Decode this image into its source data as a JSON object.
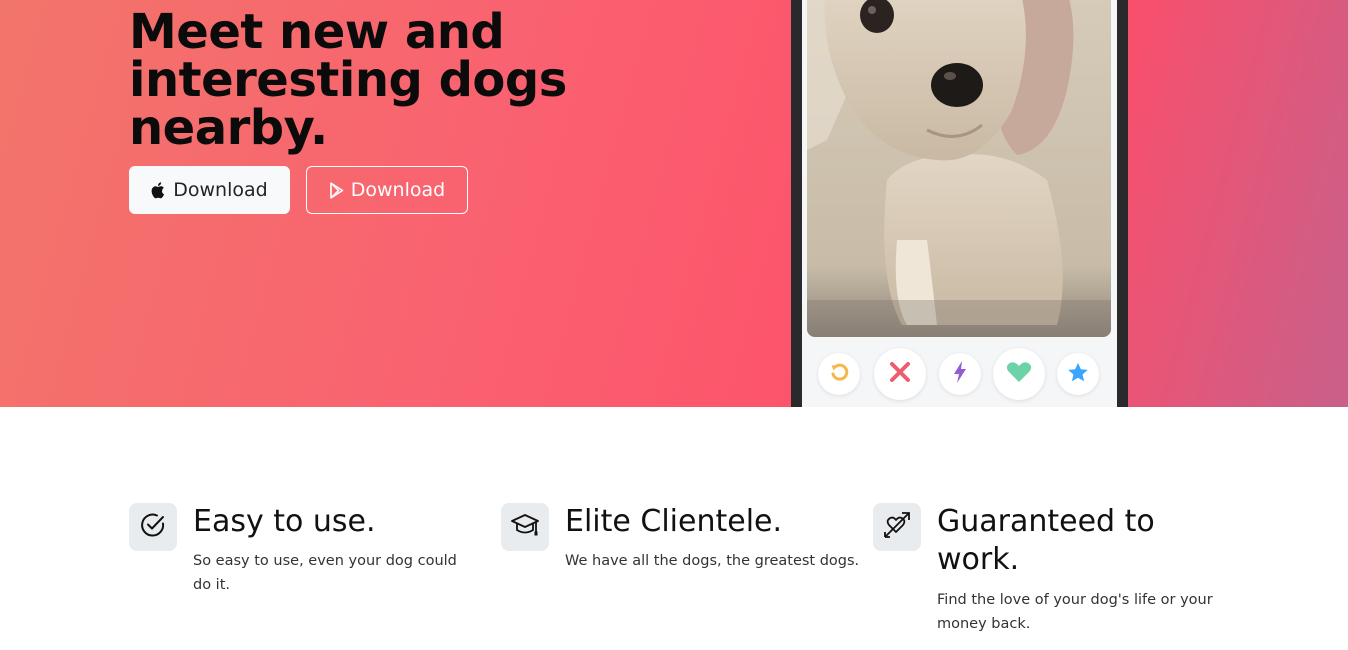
{
  "hero": {
    "headline": "Meet new and interesting dogs nearby.",
    "apple_button_label": "Download",
    "play_button_label": "Download",
    "apple_icon": "apple-logo-icon",
    "play_icon": "google-play-icon"
  },
  "phone": {
    "photo": "dog-photo",
    "actions": [
      {
        "name": "rewind",
        "icon": "rewind-icon",
        "color": "#f5b748"
      },
      {
        "name": "nope",
        "icon": "close-icon",
        "color": "#ec5e6f"
      },
      {
        "name": "boost",
        "icon": "lightning-icon",
        "color": "#915dd1"
      },
      {
        "name": "like",
        "icon": "heart-icon",
        "color": "#6bd3a7"
      },
      {
        "name": "super-like",
        "icon": "star-icon",
        "color": "#3ca4ff"
      }
    ]
  },
  "features": [
    {
      "icon": "check-circle-icon",
      "title": "Easy to use.",
      "description": "So easy to use, even your dog could do it."
    },
    {
      "icon": "graduation-cap-icon",
      "title": "Elite Clientele.",
      "description": "We have all the dogs, the greatest dogs."
    },
    {
      "icon": "heart-arrow-icon",
      "title": "Guaranteed to work.",
      "description": "Find the love of your dog's life or your money back."
    }
  ],
  "colors": {
    "hero_gradient_start": "#f2756b",
    "hero_gradient_mid": "#ff4d68",
    "hero_gradient_end": "#c8608a",
    "icon_tile": "#e9ecef"
  }
}
